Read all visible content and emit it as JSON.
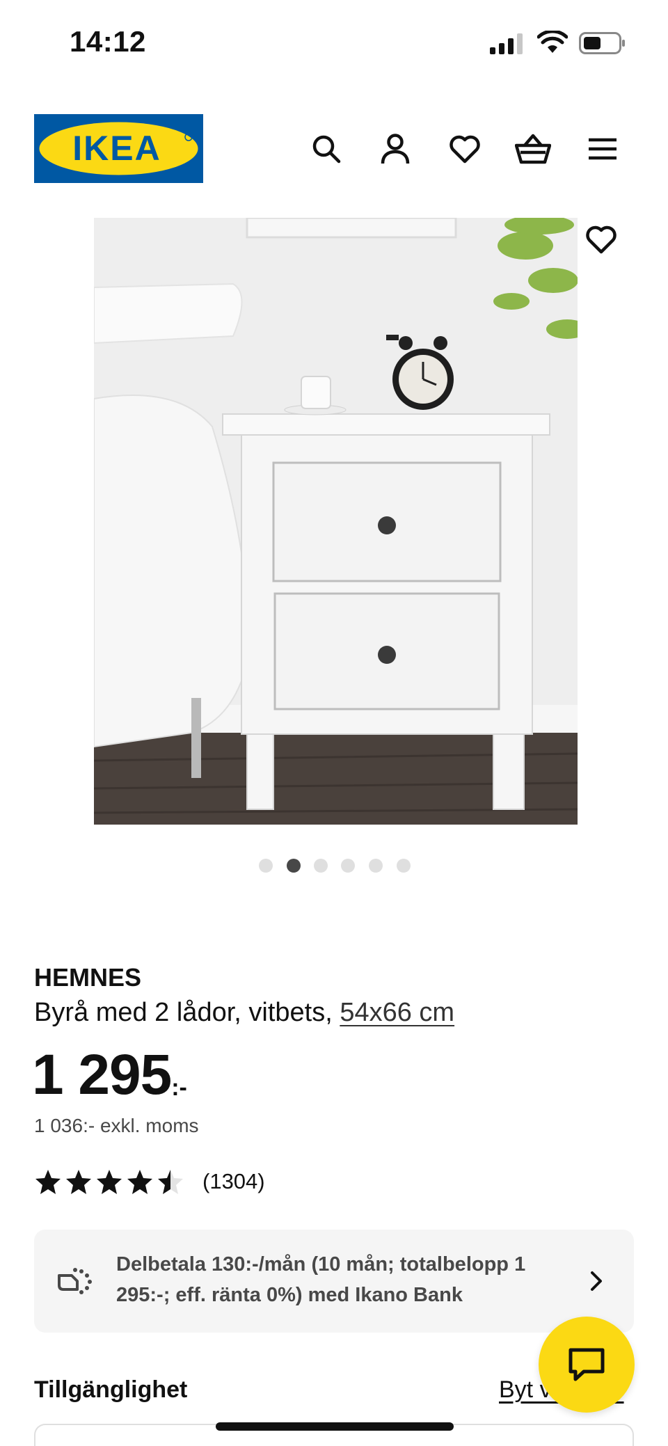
{
  "status_bar": {
    "time": "14:12"
  },
  "brand": {
    "name": "IKEA",
    "blue": "#0058a3",
    "yellow": "#fbd914"
  },
  "header": {
    "icons": [
      "search-icon",
      "account-icon",
      "heart-icon",
      "basket-icon",
      "menu-icon"
    ]
  },
  "gallery": {
    "image_count": 6,
    "active_index": 1
  },
  "product": {
    "name": "HEMNES",
    "description": "Byrå med 2 lådor, vitbets, ",
    "dimensions": "54x66 cm",
    "price_amount": "1 295",
    "price_suffix": ":-",
    "price_excl": "1 036:- exkl. moms",
    "rating_stars": 4.5,
    "rating_count": "(1304)"
  },
  "financing": {
    "text": "Delbetala 130:-/mån (10 mån; totalbelopp 1 295:-; eff. ränta 0%) med Ikano Bank"
  },
  "availability": {
    "title": "Tillgänglighet",
    "change_link": "Byt varuhus"
  }
}
